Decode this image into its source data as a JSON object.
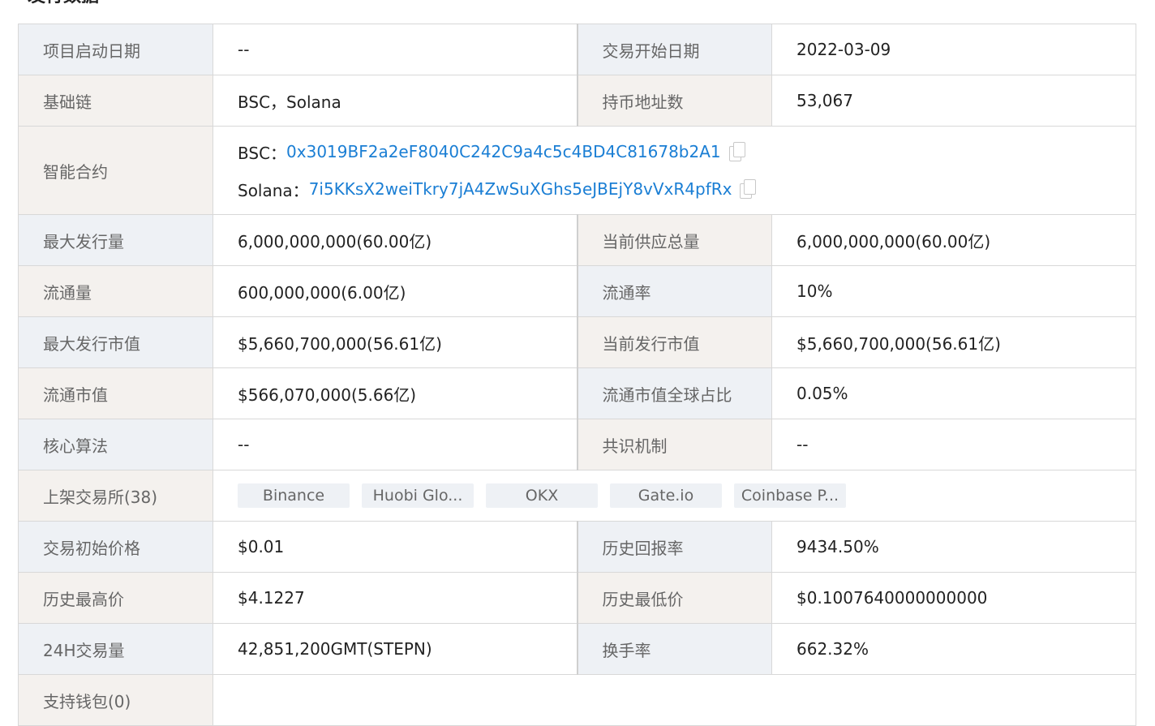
{
  "section": {
    "title": "发行数据"
  },
  "rows": {
    "launch_date": {
      "label": "项目启动日期",
      "value": "--"
    },
    "trade_start": {
      "label": "交易开始日期",
      "value": "2022-03-09"
    },
    "base_chain": {
      "label": "基础链",
      "value": "BSC，Solana"
    },
    "holders": {
      "label": "持币地址数",
      "value": "53,067"
    },
    "contract": {
      "label": "智能合约",
      "items": [
        {
          "chain": "BSC：",
          "address": "0x3019BF2a2eF8040C242C9a4c5c4BD4C81678b2A1"
        },
        {
          "chain": "Solana：",
          "address": "7i5KKsX2weiTkry7jA4ZwSuXGhs5eJBEjY8vVxR4pfRx"
        }
      ]
    },
    "max_supply": {
      "label": "最大发行量",
      "value": "6,000,000,000(60.00亿)"
    },
    "current_supply": {
      "label": "当前供应总量",
      "value": "6,000,000,000(60.00亿)"
    },
    "circulating": {
      "label": "流通量",
      "value": "600,000,000(6.00亿)"
    },
    "circ_rate": {
      "label": "流通率",
      "value": "10%"
    },
    "max_mcap": {
      "label": "最大发行市值",
      "value": "$5,660,700,000(56.61亿)"
    },
    "current_mcap": {
      "label": "当前发行市值",
      "value": "$5,660,700,000(56.61亿)"
    },
    "circ_mcap": {
      "label": "流通市值",
      "value": "$566,070,000(5.66亿)"
    },
    "global_share": {
      "label": "流通市值全球占比",
      "value": "0.05%"
    },
    "algorithm": {
      "label": "核心算法",
      "value": "--"
    },
    "consensus": {
      "label": "共识机制",
      "value": "--"
    },
    "exchanges": {
      "label": "上架交易所(38)",
      "tags": [
        "Binance",
        "Huobi Glo...",
        "OKX",
        "Gate.io",
        "Coinbase P..."
      ]
    },
    "init_price": {
      "label": "交易初始价格",
      "value": "$0.01"
    },
    "roi": {
      "label": "历史回报率",
      "value": "9434.50%"
    },
    "ath": {
      "label": "历史最高价",
      "value": "$4.1227"
    },
    "atl": {
      "label": "历史最低价",
      "value": "$0.1007640000000000"
    },
    "volume_24h": {
      "label": "24H交易量",
      "value": "42,851,200GMT(STEPN)"
    },
    "turnover": {
      "label": "换手率",
      "value": "662.32%"
    },
    "wallets": {
      "label": "支持钱包(0)",
      "value": ""
    }
  }
}
